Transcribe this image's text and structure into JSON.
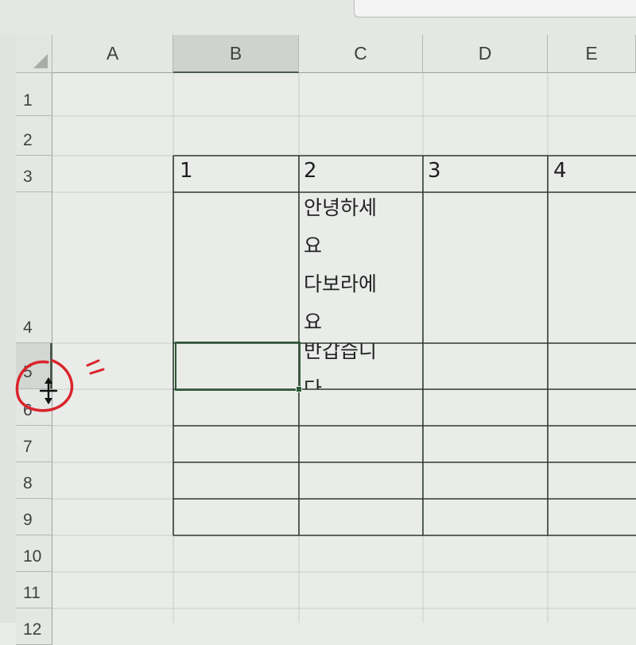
{
  "columns": [
    "A",
    "B",
    "C",
    "D",
    "E"
  ],
  "rows": [
    "1",
    "2",
    "3",
    "4",
    "5",
    "6",
    "7",
    "8",
    "9",
    "10",
    "11",
    "12"
  ],
  "selected_column": "B",
  "selected_row": "5",
  "cells": {
    "B3": "1",
    "C3": "2",
    "D3": "3",
    "E3": "4",
    "C4": "안녕하세\n요\n다보라에\n요",
    "C5": "반갑습니\n다"
  },
  "annotation": {
    "color": "#d9242b",
    "icon": "row-resize-cursor-icon"
  }
}
